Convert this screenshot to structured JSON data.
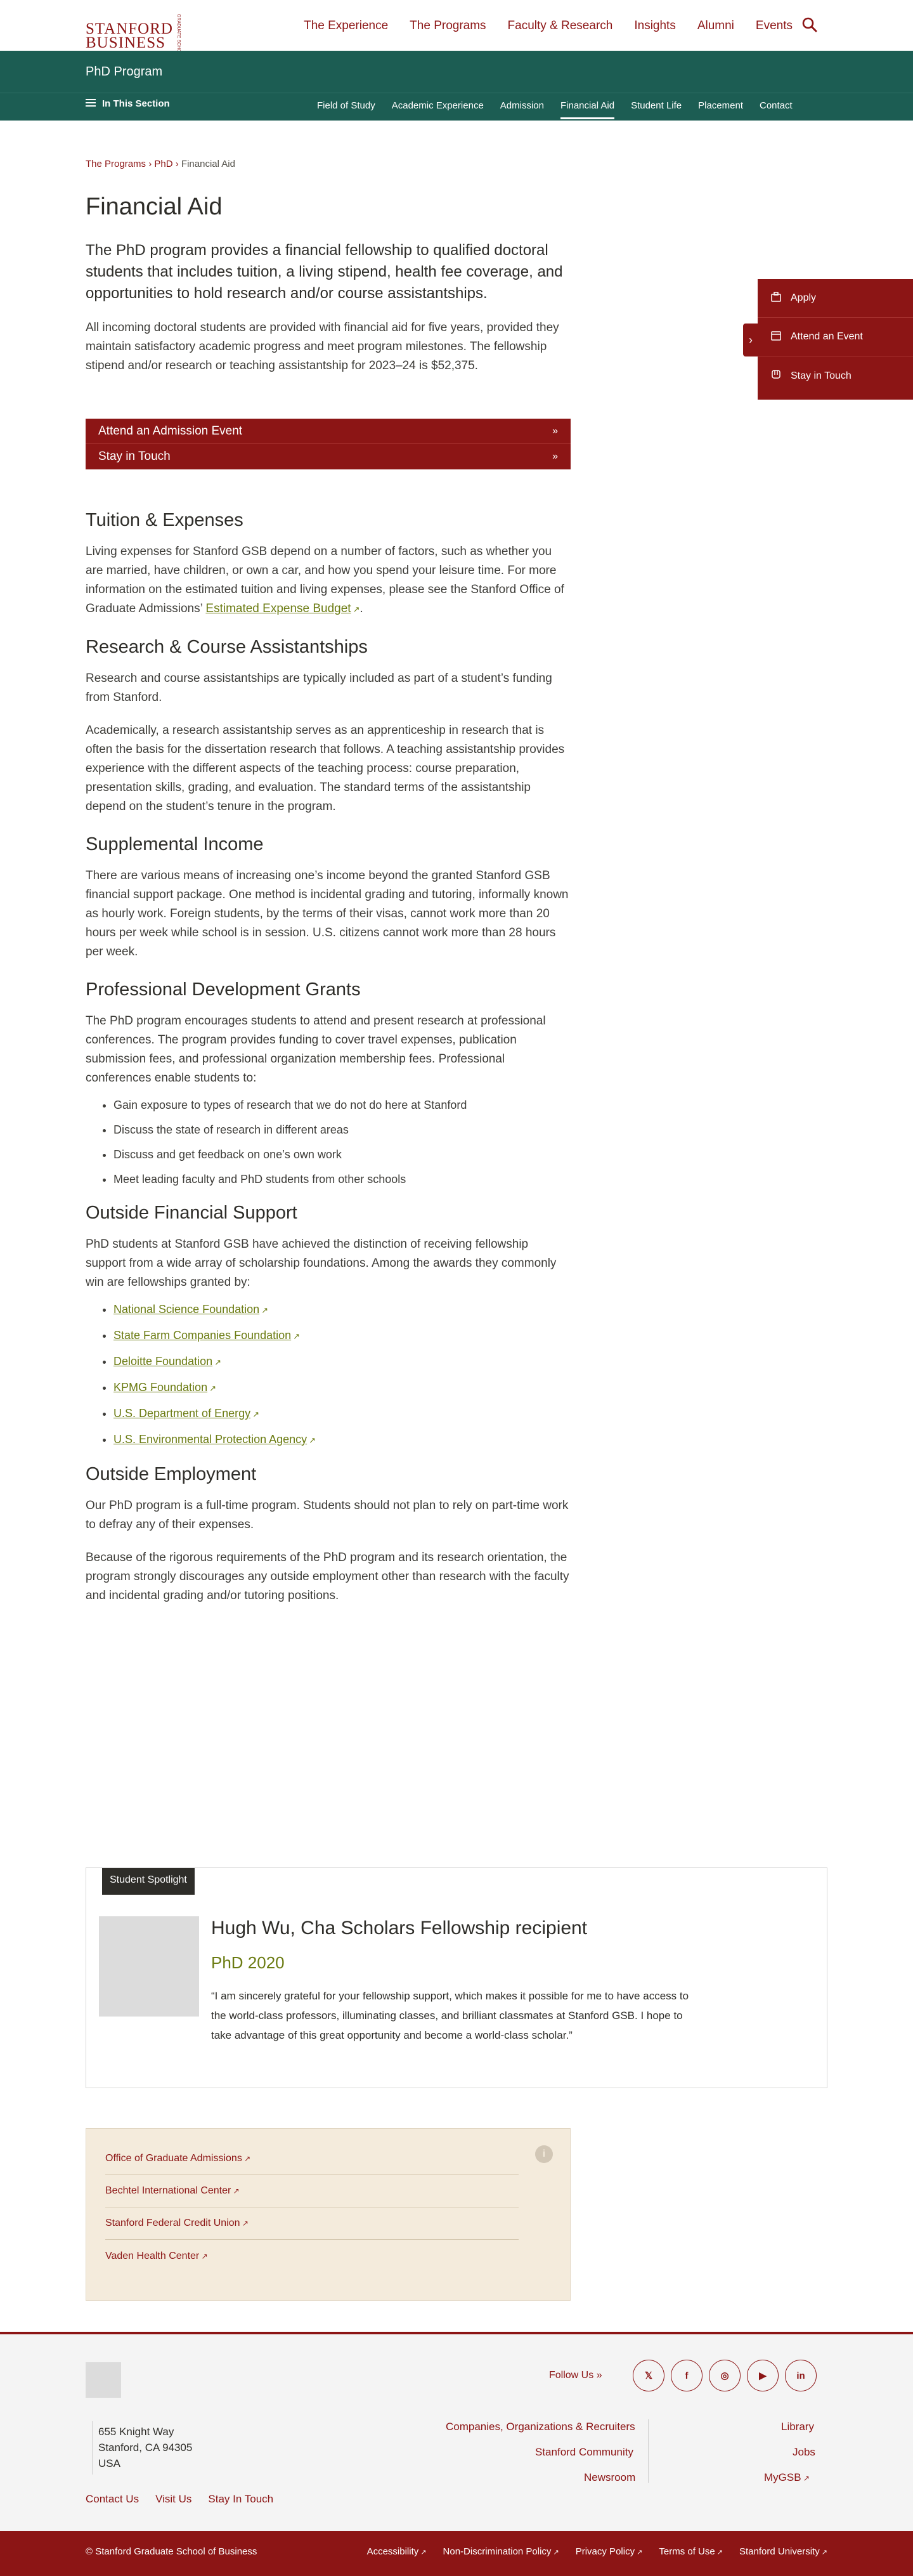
{
  "header": {
    "logo_word_line1": "STANFORD",
    "logo_word_line2": "BUSINESS",
    "logo_small": "GRADUATE SCHOOL",
    "nav": [
      "The Experience",
      "The Programs",
      "Faculty & Research",
      "Insights",
      "Alumni",
      "Events"
    ],
    "search_icon": "search-icon"
  },
  "section": {
    "title": "PhD Program",
    "in_this_section": "In This Section",
    "subnav": [
      "Field of Study",
      "Academic Experience",
      "Admission",
      "Financial Aid",
      "Student Life",
      "Placement",
      "Contact"
    ],
    "active": "Financial Aid"
  },
  "breadcrumb": {
    "items": [
      "The Programs",
      "PhD",
      "Financial Aid"
    ],
    "sep": "›"
  },
  "page": {
    "title": "Financial Aid",
    "lead": "The PhD program provides a financial fellowship to qualified doctoral students that includes tuition, a living stipend, health fee coverage, and opportunities to hold research and/or course assistantships.",
    "intro": "All incoming doctoral students are provided with financial aid for five years, provided they maintain satisfactory academic progress and meet program milestones. The fellowship stipend and/or research or teaching assistantship for 2023–24 is $52,375."
  },
  "cta": {
    "items": [
      "Attend an Admission Event",
      "Stay in Touch"
    ],
    "arrow": "»"
  },
  "sidepanel": {
    "items": [
      "Apply",
      "Attend an Event",
      "Stay in Touch"
    ],
    "toggle": "›"
  },
  "tuition": {
    "heading": "Tuition & Expenses",
    "text": "Living expenses for Stanford GSB depend on a number of factors, such as whether you are married, have children, or own a car, and how you spend your leisure time. For more information on the estimated tuition and living expenses, please see the Stanford Office of Graduate Admissions’",
    "link": "Estimated Expense Budget",
    "end": "."
  },
  "research": {
    "heading": "Research & Course Assistantships",
    "p1": "Research and course assistantships are typically included as part of a student’s funding from Stanford.",
    "p2": "Academically, a research assistantship serves as an apprenticeship in research that is often the basis for the dissertation research that follows. A teaching assistantship provides experience with the different aspects of the teaching process: course preparation, presentation skills, grading, and evaluation. The standard terms of the assistantship depend on the student’s tenure in the program."
  },
  "supplemental": {
    "heading": "Supplemental Income",
    "text": "There are various means of increasing one’s income beyond the granted Stanford GSB financial support package. One method is incidental grading and tutoring, informally known as hourly work. Foreign students, by the terms of their visas, cannot work more than 20 hours per week while school is in session. U.S. citizens cannot work more than 28 hours per week."
  },
  "grants": {
    "heading": "Professional Development Grants",
    "text": "The PhD program encourages students to attend and present research at professional conferences. The program provides funding to cover travel expenses, publication submission fees, and professional organization membership fees. Professional conferences enable students to:",
    "bullets": [
      "Gain exposure to types of research that we do not do here at Stanford",
      "Discuss the state of research in different areas",
      "Discuss and get feedback on one’s own work",
      "Meet leading faculty and PhD students from other schools"
    ]
  },
  "outside": {
    "heading": "Outside Financial Support",
    "text": "PhD students at Stanford GSB have achieved the distinction of receiving fellowship support from a wide array of scholarship foundations. Among the awards they commonly win are fellowships granted by:",
    "links": [
      "National Science Foundation",
      "State Farm Companies Foundation",
      "Deloitte Foundation",
      "KPMG Foundation",
      "U.S. Department of Energy",
      "U.S. Environmental Protection Agency"
    ]
  },
  "employment": {
    "heading": "Outside Employment",
    "p1": "Our PhD program is a full-time program. Students should not plan to rely on part-time work to defray any of their expenses.",
    "p2": "Because of the rigorous requirements of the PhD program and its research orientation, the program strongly discourages any outside employment other than research with the faculty and incidental grading and/or tutoring positions."
  },
  "spotlight": {
    "badge": "Student Spotlight",
    "name": "Hugh Wu, Cha Scholars Fellowship recipient",
    "program": "PhD 2020",
    "quote": "“I am sincerely grateful for your fellowship support, which makes it possible for me to have access to the world-class professors, illuminating classes, and brilliant classmates at Stanford GSB. I hope to take advantage of this great opportunity and become a world-class scholar.”"
  },
  "linkbox": {
    "icon": "info-icon",
    "icon_glyph": "i",
    "items": [
      "Office of Graduate Admissions",
      "Bechtel International Center",
      "Stanford Federal Credit Union",
      "Vaden Health Center"
    ]
  },
  "footer": {
    "follow": "Follow Us",
    "follow_arrow": "»",
    "social": [
      {
        "name": "twitter-icon",
        "glyph": "𝕏"
      },
      {
        "name": "facebook-icon",
        "glyph": "f"
      },
      {
        "name": "instagram-icon",
        "glyph": "◎"
      },
      {
        "name": "youtube-icon",
        "glyph": "▶"
      },
      {
        "name": "linkedin-icon",
        "glyph": "in"
      }
    ],
    "address": [
      "655 Knight Way",
      "Stanford, CA 94305",
      "USA"
    ],
    "col1": [
      "Companies, Organizations & Recruiters",
      "Stanford Community",
      "Newsroom"
    ],
    "col2": [
      "Library",
      "Jobs",
      "MyGSB"
    ],
    "contact": [
      "Contact Us",
      "Visit Us",
      "Stay In Touch"
    ],
    "copyright": "© Stanford Graduate School of Business",
    "bottom_links": [
      "Accessibility",
      "Non-Discrimination Policy",
      "Privacy Policy",
      "Terms of Use",
      "Stanford University"
    ]
  },
  "colors": {
    "cardinal": "#8c1515",
    "teal": "#1c5d53",
    "link_green": "#6b7b12",
    "sand": "#f4ebdc"
  }
}
